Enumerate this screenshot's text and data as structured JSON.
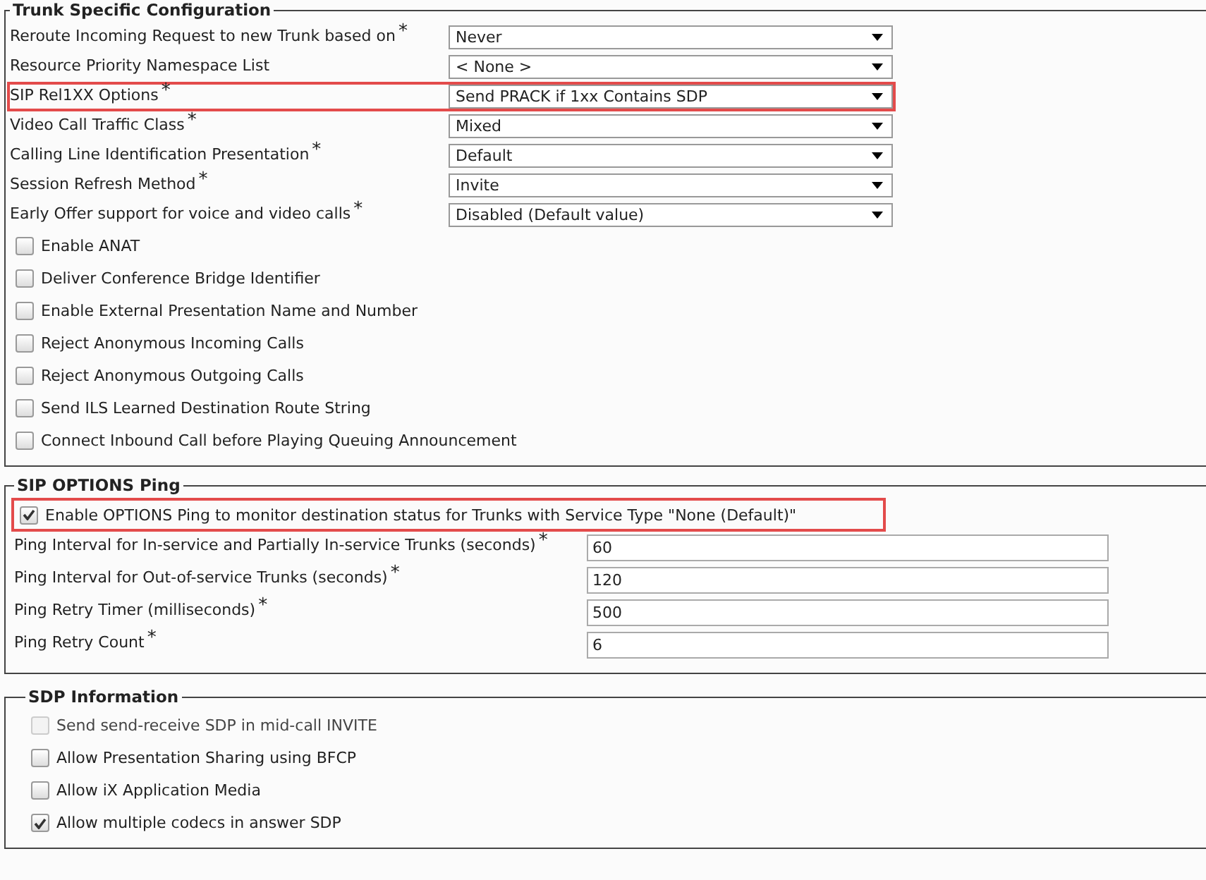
{
  "sections": [
    {
      "title": "Trunk Specific Configuration",
      "kind": "dropdowns",
      "fields": [
        {
          "label": "Reroute Incoming Request to new Trunk based on$^{*}$",
          "value": "Never",
          "highlighted": false
        },
        {
          "label": "Resource Priority Namespace List",
          "value": "< None >",
          "highlighted": false
        },
        {
          "label": "SIP Rel1XX Options$^{*}$",
          "value": "Send PRACK if 1xx Contains SDP",
          "highlighted": true
        },
        {
          "label": "Video Call Traffic Class$^{*}$",
          "value": "Mixed",
          "highlighted": false
        },
        {
          "label": "Calling Line Identification Presentation$^{*}$",
          "value": "Default",
          "highlighted": false
        },
        {
          "label": "Session Refresh Method$^{*}$",
          "value": "Invite",
          "highlighted": false
        },
        {
          "label": "Early Offer support for voice and video calls$^{*}$",
          "value": "Disabled (Default value)",
          "highlighted": false
        }
      ],
      "checkboxes": [
        {
          "label": "Enable ANAT",
          "checked": false,
          "disabled": false,
          "highlighted": false
        },
        {
          "label": "Deliver Conference Bridge Identifier",
          "checked": false,
          "disabled": false,
          "highlighted": false
        },
        {
          "label": "Enable External Presentation Name and Number",
          "checked": false,
          "disabled": false,
          "highlighted": false
        },
        {
          "label": "Reject Anonymous Incoming Calls",
          "checked": false,
          "disabled": false,
          "highlighted": false
        },
        {
          "label": "Reject Anonymous Outgoing Calls",
          "checked": false,
          "disabled": false,
          "highlighted": false
        },
        {
          "label": "Send ILS Learned Destination Route String",
          "checked": false,
          "disabled": false,
          "highlighted": false
        },
        {
          "label": "Connect Inbound Call before Playing Queuing Announcement",
          "checked": false,
          "disabled": false,
          "highlighted": false
        }
      ]
    },
    {
      "title": "SIP OPTIONS Ping",
      "kind": "inputs",
      "checkboxes": [
        {
          "label": "Enable OPTIONS Ping to monitor destination status for Trunks with Service Type \"None (Default)\"",
          "checked": true,
          "disabled": false,
          "highlighted": true
        }
      ],
      "fields": [
        {
          "label": "Ping Interval for In-service and Partially In-service Trunks (seconds)$^{*}$",
          "value": "60",
          "highlighted": false
        },
        {
          "label": "Ping Interval for Out-of-service Trunks (seconds)$^{*}$",
          "value": "120",
          "highlighted": false
        },
        {
          "label": "Ping Retry Timer (milliseconds)$^{*}$",
          "value": "500",
          "highlighted": false
        },
        {
          "label": "Ping Retry Count$^{*}$",
          "value": "6",
          "highlighted": false
        }
      ]
    },
    {
      "title": "SDP Information",
      "kind": "checks",
      "checkboxes": [
        {
          "label": "Send send-receive SDP in mid-call INVITE",
          "checked": false,
          "disabled": true,
          "highlighted": false
        },
        {
          "label": "Allow Presentation Sharing using BFCP",
          "checked": false,
          "disabled": false,
          "highlighted": false
        },
        {
          "label": "Allow iX Application Media",
          "checked": false,
          "disabled": false,
          "highlighted": false
        },
        {
          "label": "Allow multiple codecs in answer SDP",
          "checked": true,
          "disabled": false,
          "highlighted": false
        }
      ]
    }
  ]
}
